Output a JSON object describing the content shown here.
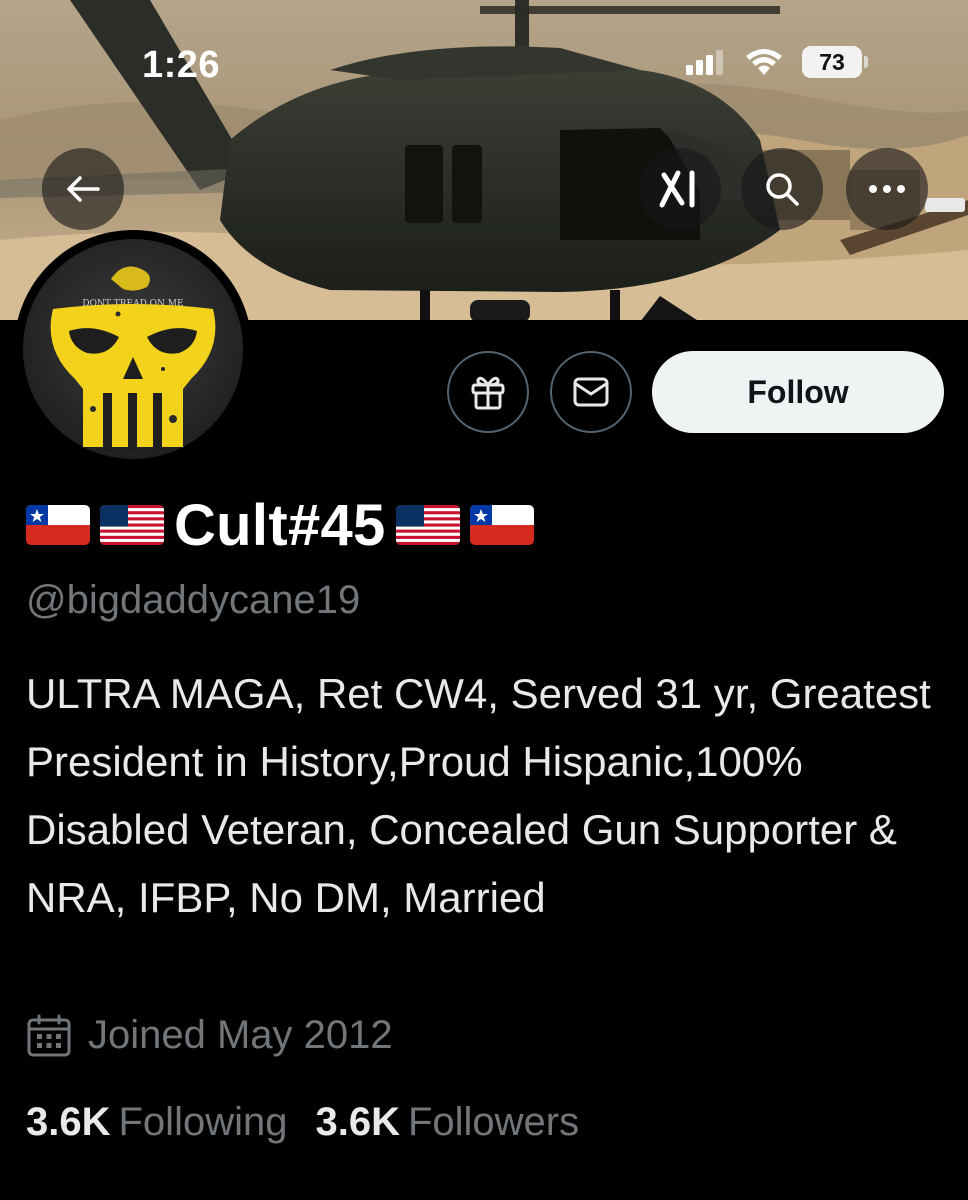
{
  "status_bar": {
    "time": "1:26",
    "battery": "73",
    "icons": [
      "signal-icon",
      "wifi-icon",
      "battery-icon"
    ]
  },
  "nav": {
    "icons": [
      "back-arrow-icon",
      "grok-icon",
      "search-icon",
      "more-icon"
    ]
  },
  "actions": {
    "icons": [
      "gift-icon",
      "mail-icon"
    ],
    "follow_label": "Follow"
  },
  "avatar": {
    "caption": "DONT TREAD ON ME"
  },
  "profile": {
    "display_name": "Cult#45",
    "handle": "@bigdaddycane19",
    "bio": "ULTRA MAGA, Ret CW4, Served 31 yr, Greatest President in History,Proud Hispanic,100% Disabled Veteran, Concealed Gun Supporter & NRA, IFBP, No DM, Married",
    "joined": "Joined May 2012",
    "following_count": "3.6K",
    "following_label": "Following",
    "followers_count": "3.6K",
    "followers_label": "Followers"
  },
  "colors": {
    "background": "#000000",
    "secondary_text": "#71767b",
    "follow_button": "#eff3f4",
    "punisher_yellow": "#f2d21b"
  }
}
